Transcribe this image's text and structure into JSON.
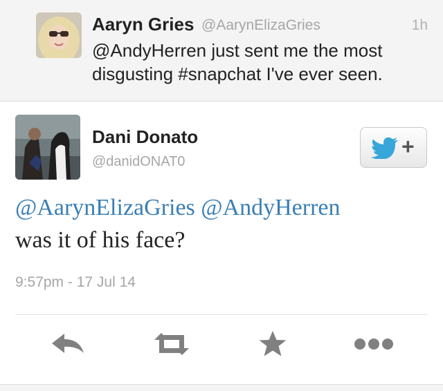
{
  "reply_tweet": {
    "author_name": "Aaryn Gries",
    "author_handle": "@AarynElizaGries",
    "time": "1h",
    "text": "@AndyHerren just sent me the most disgusting #snapchat I've ever seen."
  },
  "main_tweet": {
    "author_name": "Dani Donato",
    "author_handle": "@danidONAT0",
    "mentions": [
      "@AarynElizaGries",
      "@AndyHerren"
    ],
    "body": "was it of his face?",
    "timestamp": "9:57pm - 17 Jul 14",
    "follow_icon": "twitter-bird-follow",
    "accent_color": "#3a7fb5"
  },
  "actions": [
    "reply-icon",
    "retweet-icon",
    "favorite-icon",
    "more-icon"
  ]
}
